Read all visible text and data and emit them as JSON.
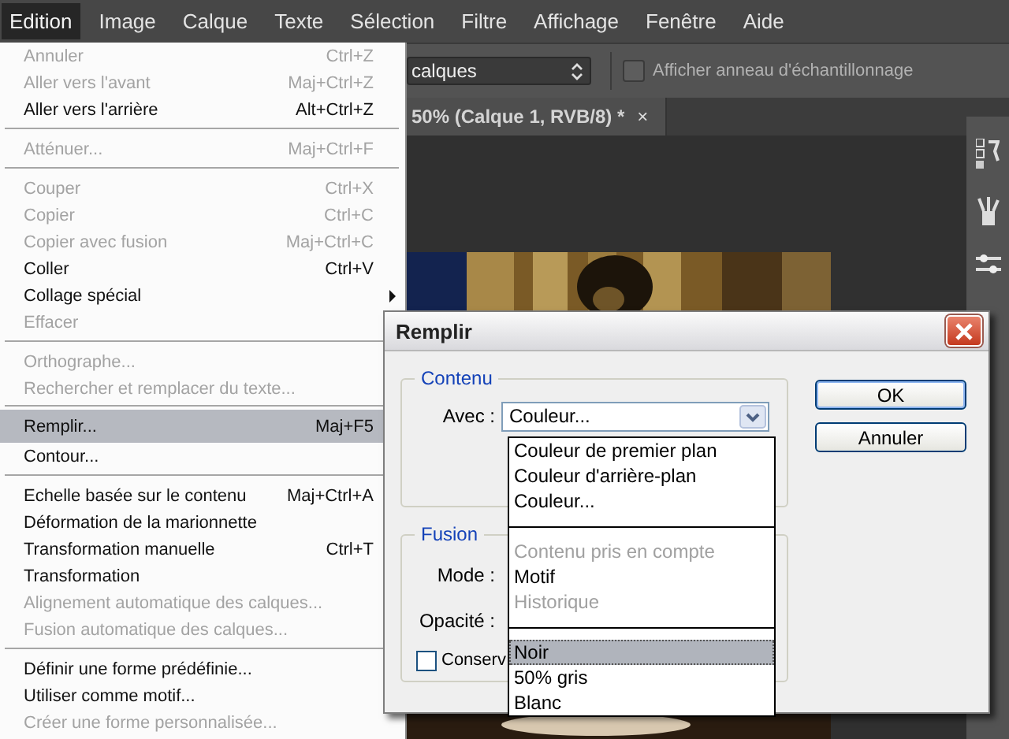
{
  "menu_bar": [
    {
      "label": "Edition",
      "selected": true
    },
    {
      "label": "Image",
      "selected": false
    },
    {
      "label": "Calque",
      "selected": false
    },
    {
      "label": "Texte",
      "selected": false
    },
    {
      "label": "Sélection",
      "selected": false
    },
    {
      "label": "Filtre",
      "selected": false
    },
    {
      "label": "Affichage",
      "selected": false
    },
    {
      "label": "Fenêtre",
      "selected": false
    },
    {
      "label": "Aide",
      "selected": false
    }
  ],
  "options_bar": {
    "dropdown": "calques",
    "checkbox": {
      "label": "Afficher anneau d'échantillonnage",
      "checked": false
    }
  },
  "document_tab": {
    "title": "50% (Calque 1, RVB/8) *",
    "close": "×"
  },
  "edit_menu": {
    "groups": [
      [
        {
          "label": "Annuler",
          "shortcut": "Ctrl+Z",
          "disabled": true,
          "selected": false,
          "submenu": false
        },
        {
          "label": "Aller vers l'avant",
          "shortcut": "Maj+Ctrl+Z",
          "disabled": true,
          "selected": false,
          "submenu": false
        },
        {
          "label": "Aller vers l'arrière",
          "shortcut": "Alt+Ctrl+Z",
          "disabled": false,
          "selected": false,
          "submenu": false
        }
      ],
      [
        {
          "label": "Atténuer...",
          "shortcut": "Maj+Ctrl+F",
          "disabled": true,
          "selected": false,
          "submenu": false
        }
      ],
      [
        {
          "label": "Couper",
          "shortcut": "Ctrl+X",
          "disabled": true,
          "selected": false,
          "submenu": false
        },
        {
          "label": "Copier",
          "shortcut": "Ctrl+C",
          "disabled": true,
          "selected": false,
          "submenu": false
        },
        {
          "label": "Copier avec fusion",
          "shortcut": "Maj+Ctrl+C",
          "disabled": true,
          "selected": false,
          "submenu": false
        },
        {
          "label": "Coller",
          "shortcut": "Ctrl+V",
          "disabled": false,
          "selected": false,
          "submenu": false
        },
        {
          "label": "Collage spécial",
          "disabled": false,
          "selected": false,
          "submenu": true
        },
        {
          "label": "Effacer",
          "disabled": true,
          "selected": false,
          "submenu": false
        }
      ],
      [
        {
          "label": "Orthographe...",
          "disabled": true,
          "selected": false,
          "submenu": false
        },
        {
          "label": "Rechercher et remplacer du texte...",
          "disabled": true,
          "selected": false,
          "submenu": false
        }
      ],
      [
        {
          "label": "Remplir...",
          "shortcut": "Maj+F5",
          "disabled": false,
          "selected": true,
          "submenu": false
        },
        {
          "label": "Contour...",
          "disabled": false,
          "selected": false,
          "submenu": false
        }
      ],
      [
        {
          "label": "Echelle basée sur le contenu",
          "shortcut": "Maj+Ctrl+A",
          "disabled": false,
          "selected": false,
          "submenu": false
        },
        {
          "label": "Déformation de la marionnette",
          "disabled": false,
          "selected": false,
          "submenu": false
        },
        {
          "label": "Transformation manuelle",
          "shortcut": "Ctrl+T",
          "disabled": false,
          "selected": false,
          "submenu": false
        },
        {
          "label": "Transformation",
          "disabled": false,
          "selected": false,
          "submenu": false
        },
        {
          "label": "Alignement automatique des calques...",
          "disabled": true,
          "selected": false,
          "submenu": false
        },
        {
          "label": "Fusion automatique des calques...",
          "disabled": true,
          "selected": false,
          "submenu": false
        }
      ],
      [
        {
          "label": "Définir une forme prédéfinie...",
          "disabled": false,
          "selected": false,
          "submenu": false
        },
        {
          "label": "Utiliser comme motif...",
          "disabled": false,
          "selected": false,
          "submenu": false
        },
        {
          "label": "Créer une forme personnalisée...",
          "disabled": true,
          "selected": false,
          "submenu": false
        }
      ]
    ]
  },
  "dialog": {
    "title": "Remplir",
    "contents": {
      "legend": "Contenu",
      "with_label": "Avec :",
      "with_value": "Couleur..."
    },
    "blending": {
      "legend": "Fusion",
      "mode_label": "Mode :",
      "opacity_label": "Opacité :",
      "preserve": {
        "label": "Conserv",
        "checked": false
      }
    },
    "buttons": [
      {
        "label": "OK",
        "default": true
      },
      {
        "label": "Annuler",
        "default": false
      }
    ],
    "dropdown_list": {
      "groups": [
        [
          {
            "label": "Couleur de premier plan",
            "disabled": false,
            "selected": false
          },
          {
            "label": "Couleur d'arrière-plan",
            "disabled": false,
            "selected": false
          },
          {
            "label": "Couleur...",
            "disabled": false,
            "selected": false
          }
        ],
        [
          {
            "label": "Contenu pris en compte",
            "disabled": true,
            "selected": false
          },
          {
            "label": "Motif",
            "disabled": false,
            "selected": false
          },
          {
            "label": "Historique",
            "disabled": true,
            "selected": false
          }
        ],
        [
          {
            "label": "Noir",
            "disabled": false,
            "selected": true
          },
          {
            "label": "50% gris",
            "disabled": false,
            "selected": false
          },
          {
            "label": "Blanc",
            "disabled": false,
            "selected": false
          }
        ]
      ]
    }
  }
}
